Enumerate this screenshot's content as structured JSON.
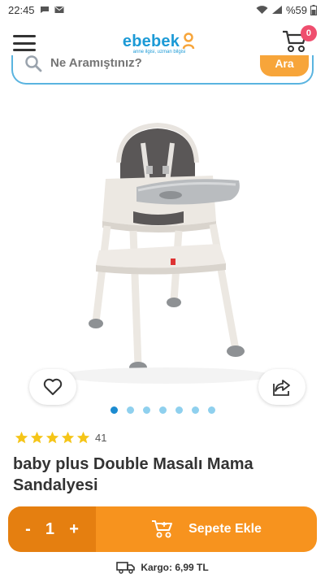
{
  "status_bar": {
    "time": "22:45",
    "battery": "%59"
  },
  "header": {
    "logo_text": "ebebek",
    "logo_tagline": "anne ilgisi, uzman bilgisi",
    "cart_count": "0"
  },
  "search": {
    "placeholder": "Ne Aramıştınız?",
    "button_label": "Ara"
  },
  "gallery": {
    "image_count": 7,
    "active_index": 0
  },
  "product": {
    "rating_stars": 5,
    "rating_count": "41",
    "title": "baby plus Double Masalı Mama Sandalyesi"
  },
  "cart_bar": {
    "minus": "-",
    "quantity": "1",
    "plus": "+",
    "add_label": "Sepete Ekle"
  },
  "shipping": {
    "text": "Kargo: 6,99 TL"
  },
  "colors": {
    "brand_blue": "#1c9ad6",
    "accent_orange": "#f7931e",
    "badge_pink": "#ef4e6e",
    "star_gold": "#f5c518"
  }
}
